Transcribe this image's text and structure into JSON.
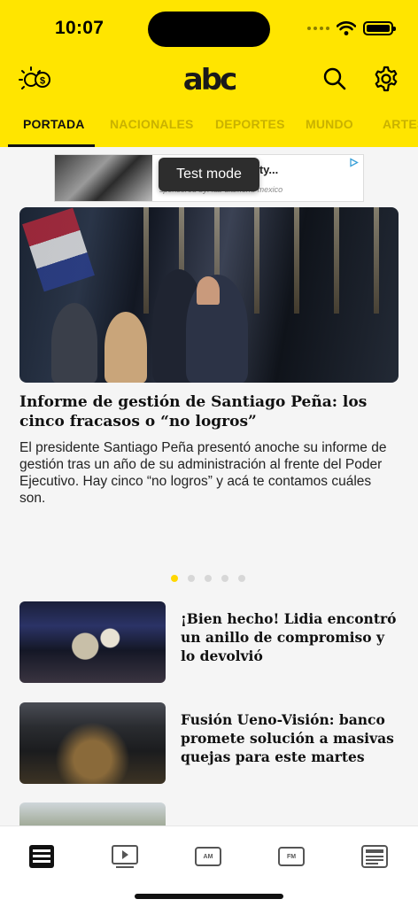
{
  "status": {
    "time": "10:07"
  },
  "header": {
    "logo_text": "abc",
    "brand_color": "#ffe500",
    "left_icon": "sun-currency-icon",
    "search_icon": "search-icon",
    "settings_icon": "gear-icon"
  },
  "tabs": [
    {
      "label": "PORTADA",
      "active": true
    },
    {
      "label": "NACIONALES",
      "active": false
    },
    {
      "label": "DEPORTES",
      "active": false
    },
    {
      "label": "MUNDO",
      "active": false
    },
    {
      "label": "ARTES",
      "active": false
    }
  ],
  "ad": {
    "title": "co: High-Quality...",
    "sponsor": "sponsored by: lab diamond mexico",
    "toast": "Test mode"
  },
  "hero": {
    "headline": "Informe de gestión de Santiago Peña: los cinco fracasos o “no logros”",
    "summary": "El presidente Santiago Peña presentó anoche su informe de gestión tras un año de su administración al frente del Poder Ejecutivo. Hay cinco “no logros” y acá te contamos cuáles son.",
    "carousel_active_index": 0,
    "carousel_count": 5
  },
  "articles": [
    {
      "title": "¡Bien hecho! Lidia encontró un anillo de compromiso  y lo devolvió"
    },
    {
      "title": "Fusión Ueno-Visión: banco promete solución a masivas quejas para este martes"
    },
    {
      "title": ""
    }
  ],
  "bottom_nav": [
    {
      "icon": "newspaper-icon",
      "label": "",
      "active": true
    },
    {
      "icon": "video-player-icon",
      "label": ""
    },
    {
      "icon": "radio-am-icon",
      "label": "AM"
    },
    {
      "icon": "radio-fm-icon",
      "label": "FM"
    },
    {
      "icon": "digital-edition-icon",
      "label": ""
    }
  ]
}
